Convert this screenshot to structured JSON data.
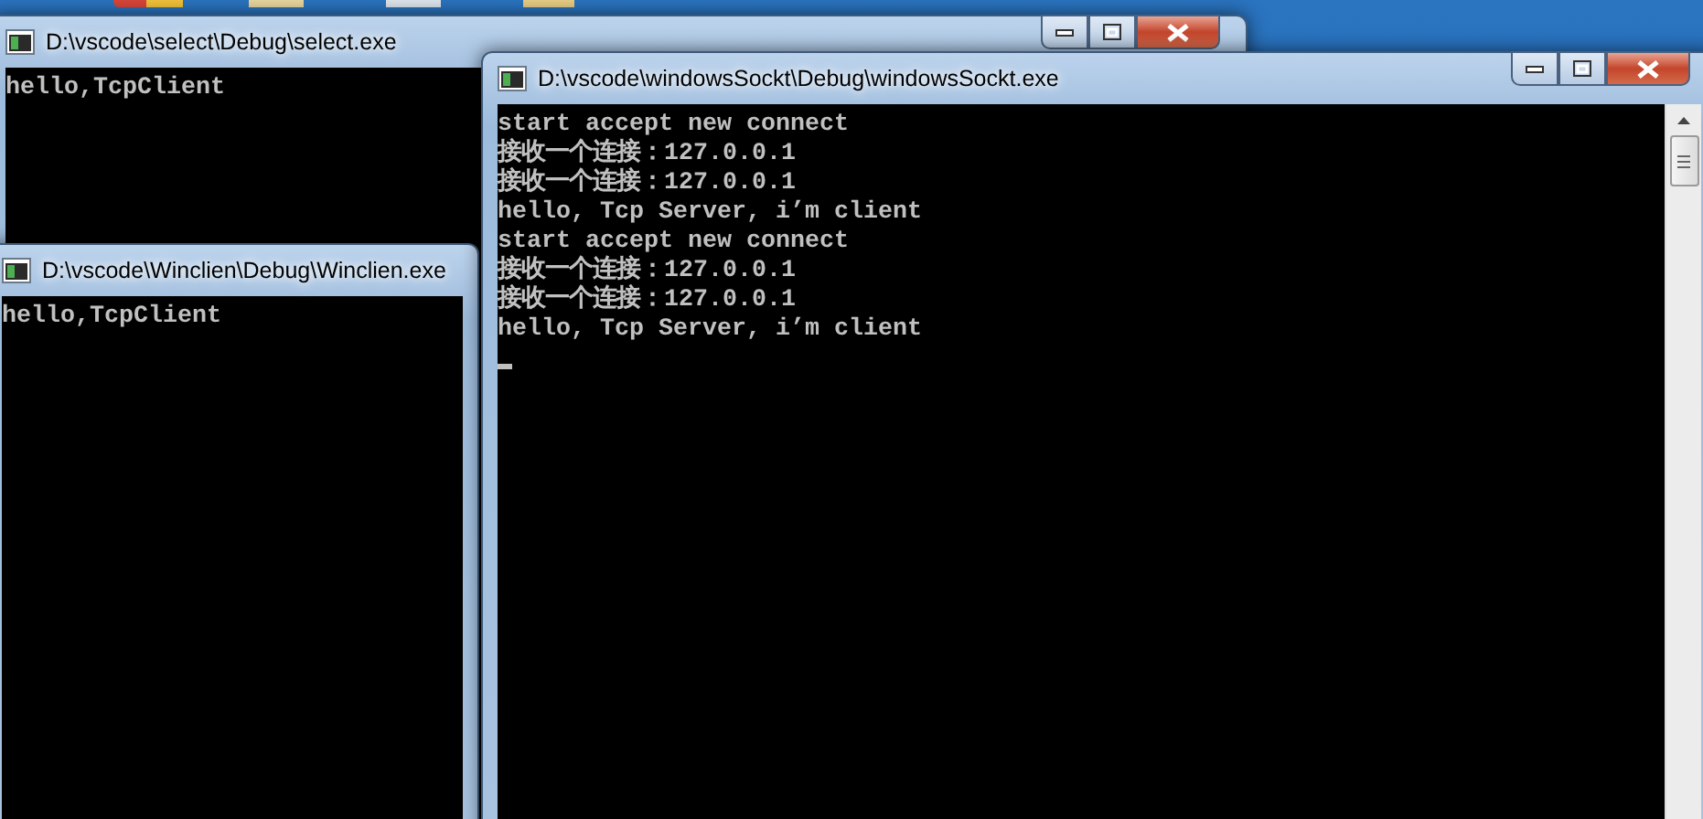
{
  "windows": [
    {
      "title": "D:\\vscode\\select\\Debug\\select.exe",
      "caption_buttons": true,
      "lines": [
        "hello,TcpClient"
      ]
    },
    {
      "title": "D:\\vscode\\Winclien\\Debug\\Winclien.exe",
      "lines": [
        "hello,TcpClient"
      ]
    },
    {
      "title": "D:\\vscode\\windowsSockt\\Debug\\windowsSockt.exe",
      "caption_buttons": true,
      "lines": [
        "start accept new connect",
        "接收一个连接：127.0.0.1",
        "接收一个连接：127.0.0.1",
        "hello, Tcp Server, i’m client",
        "start accept new connect",
        "接收一个连接：127.0.0.1",
        "接收一个连接：127.0.0.1",
        "hello, Tcp Server, i’m client"
      ],
      "cursor": true,
      "scrollbar": true
    }
  ]
}
